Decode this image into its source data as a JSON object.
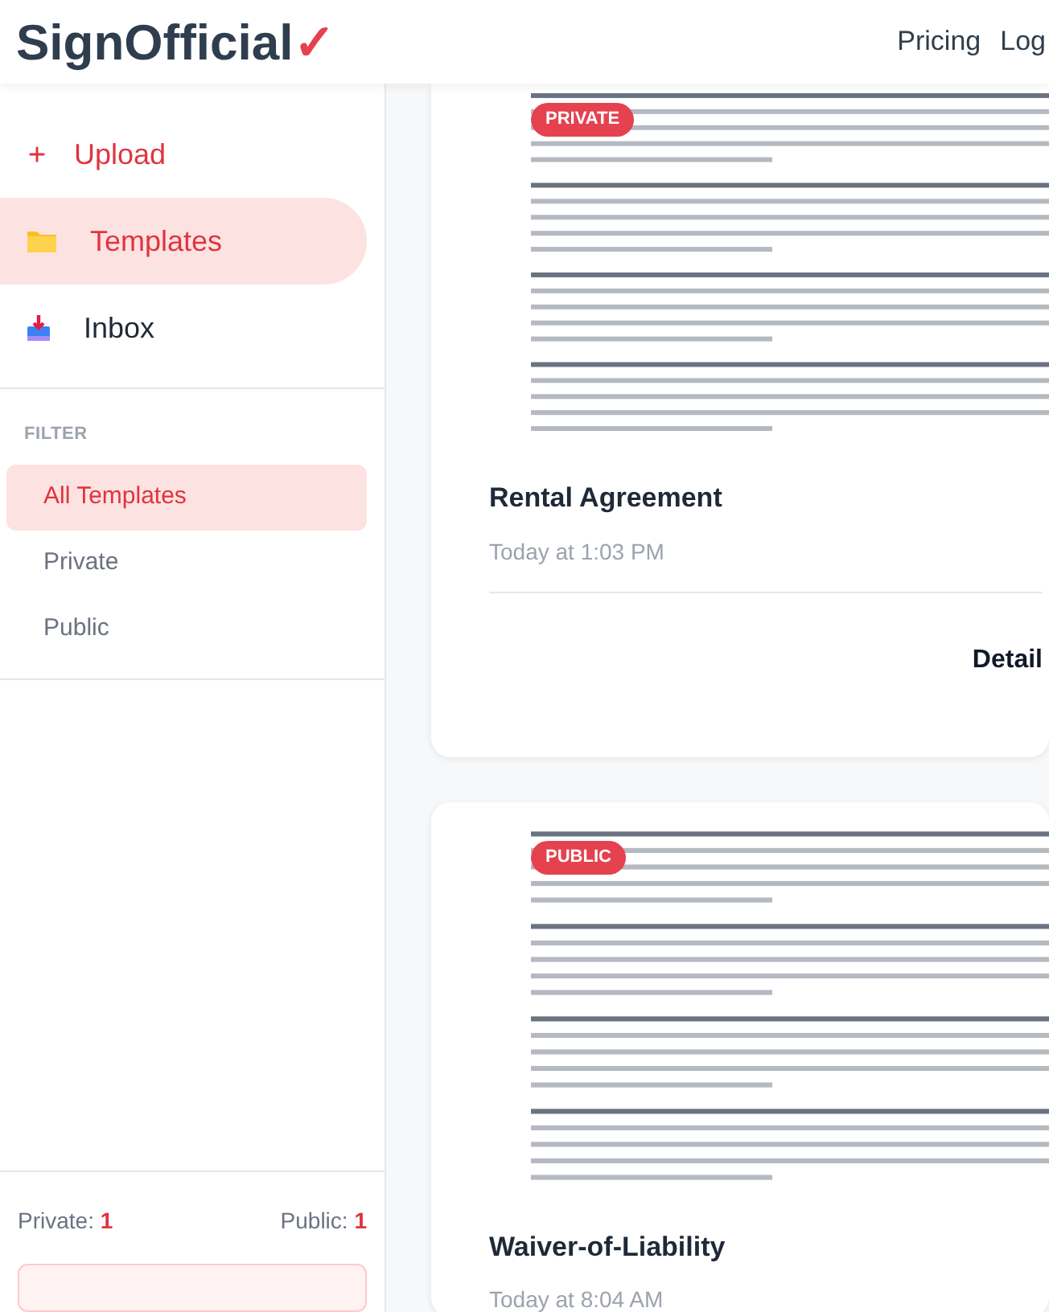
{
  "header": {
    "logo": "SignOfficial",
    "logo_mark": "✓",
    "nav": [
      "Pricing",
      "Log"
    ]
  },
  "sidebar": {
    "items": [
      {
        "kind": "action",
        "label": "Upload",
        "selected": false
      },
      {
        "kind": "folder",
        "label": "Templates",
        "selected": true
      },
      {
        "kind": "inbox",
        "label": "Inbox",
        "selected": false
      }
    ],
    "filter_title": "FILTER",
    "filters": [
      {
        "label": "All Templates",
        "selected": true
      },
      {
        "label": "Private",
        "selected": false
      },
      {
        "label": "Public",
        "selected": false
      }
    ],
    "counts": [
      {
        "label": "Private:",
        "value": "1"
      },
      {
        "label": "Public:",
        "value": "1"
      }
    ]
  },
  "templates": [
    {
      "badge": "PRIVATE",
      "title": "Rental Agreement",
      "date": "Today at 1:03 PM",
      "action": "Detail"
    },
    {
      "badge": "PUBLIC",
      "title": "Waiver-of-Liability",
      "date": "Today at 8:04 AM"
    }
  ]
}
